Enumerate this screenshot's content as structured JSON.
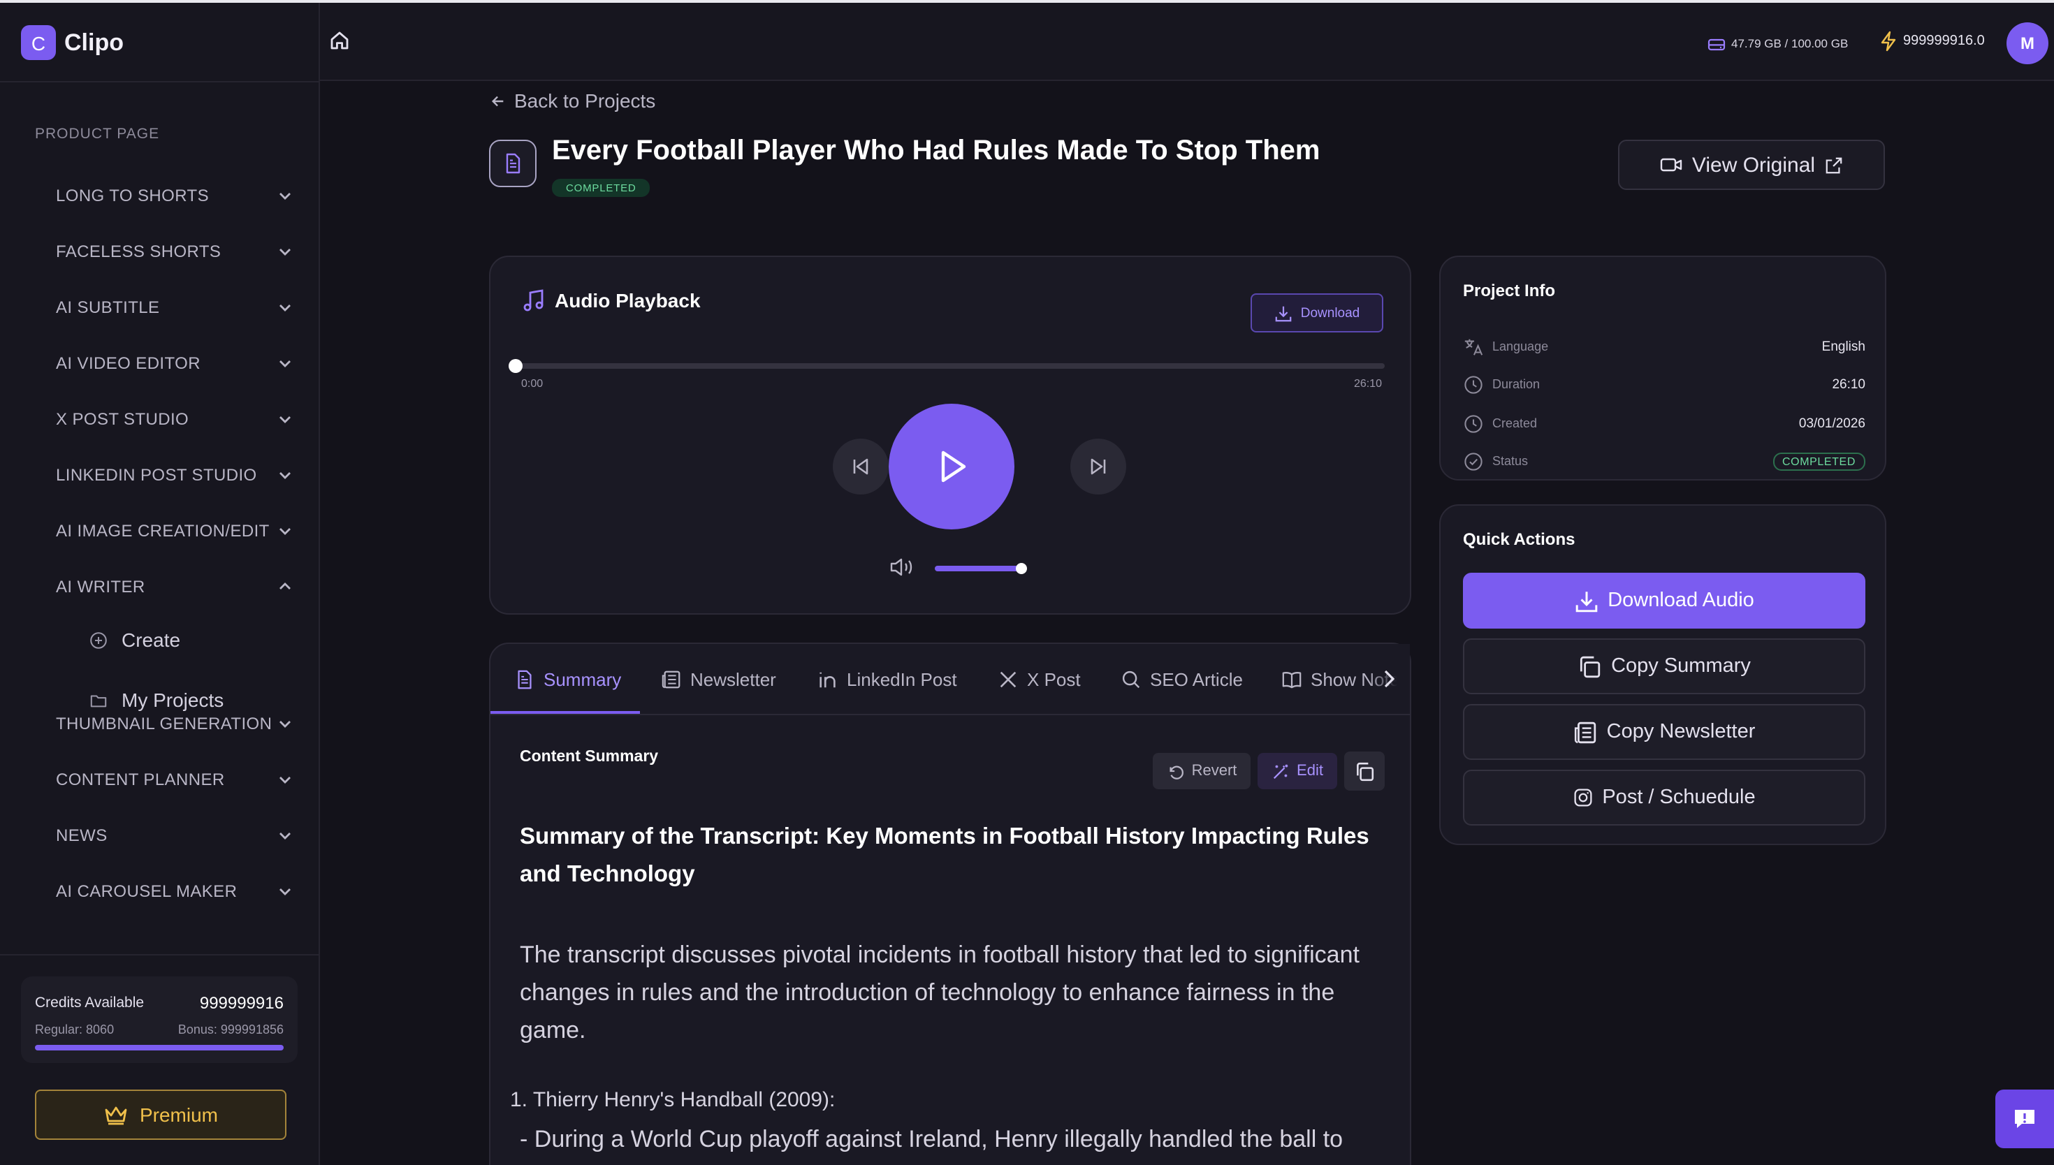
{
  "brand": {
    "logo_letter": "C",
    "name": "Clipo"
  },
  "sidebar": {
    "section_label": "PRODUCT PAGE",
    "items": [
      {
        "label": "LONG TO SHORTS",
        "expanded": false
      },
      {
        "label": "FACELESS SHORTS",
        "expanded": false
      },
      {
        "label": "AI SUBTITLE",
        "expanded": false
      },
      {
        "label": "AI VIDEO EDITOR",
        "expanded": false
      },
      {
        "label": "X POST STUDIO",
        "expanded": false
      },
      {
        "label": "LINKEDIN POST STUDIO",
        "expanded": false
      },
      {
        "label": "AI IMAGE CREATION/EDIT",
        "expanded": false
      },
      {
        "label": "AI WRITER",
        "expanded": true
      },
      {
        "label": "THUMBNAIL GENERATION",
        "expanded": false
      },
      {
        "label": "CONTENT PLANNER",
        "expanded": false
      },
      {
        "label": "NEWS",
        "expanded": false
      },
      {
        "label": "AI CAROUSEL MAKER",
        "expanded": false
      }
    ],
    "sub_items": [
      {
        "label": "Create",
        "icon": "plus-circle-icon"
      },
      {
        "label": "My Projects",
        "icon": "folder-icon"
      }
    ],
    "credits": {
      "label": "Credits Available",
      "value": "999999916",
      "regular": "Regular: 8060",
      "bonus": "Bonus: 999991856",
      "progress": 1.0
    },
    "premium_label": "Premium"
  },
  "header": {
    "storage": "47.79 GB / 100.00 GB",
    "credits": "999999916.0",
    "avatar_initial": "M"
  },
  "page": {
    "back_label": "Back to Projects",
    "title": "Every Football Player Who Had Rules Made To Stop Them",
    "status_badge": "COMPLETED",
    "view_original_label": "View Original"
  },
  "audio": {
    "title": "Audio Playback",
    "download_label": "Download",
    "current_time": "0:00",
    "total_time": "26:10",
    "progress": 0.0,
    "volume": 1.0
  },
  "tabs": {
    "items": [
      {
        "label": "Summary",
        "icon": "document-icon",
        "active": true
      },
      {
        "label": "Newsletter",
        "icon": "newspaper-icon",
        "active": false
      },
      {
        "label": "LinkedIn Post",
        "icon": "linkedin-icon",
        "active": false
      },
      {
        "label": "X Post",
        "icon": "x-icon",
        "active": false
      },
      {
        "label": "SEO Article",
        "icon": "search-icon",
        "active": false
      },
      {
        "label": "Show Notes",
        "icon": "book-icon",
        "active": false
      }
    ]
  },
  "content": {
    "label": "Content Summary",
    "revert_label": "Revert",
    "edit_label": "Edit",
    "heading": "Summary of the Transcript: Key Moments in Football History Impacting Rules and Technology",
    "paragraph": "The transcript discusses pivotal incidents in football history that led to significant changes in rules and the introduction of technology to enhance fairness in the game.",
    "item_1": "1. Thierry Henry's Handball (2009):",
    "bullet_1": "- During a World Cup playoff against Ireland, Henry illegally handled the ball to"
  },
  "project_info": {
    "title": "Project Info",
    "rows": [
      {
        "label": "Language",
        "value": "English",
        "icon": "translate-icon"
      },
      {
        "label": "Duration",
        "value": "26:10",
        "icon": "clock-icon"
      },
      {
        "label": "Created",
        "value": "03/01/2026",
        "icon": "clock-icon"
      },
      {
        "label": "Status",
        "value": "COMPLETED",
        "icon": "check-circle-icon"
      }
    ]
  },
  "quick_actions": {
    "title": "Quick Actions",
    "buttons": [
      {
        "label": "Download Audio",
        "icon": "download-icon"
      },
      {
        "label": "Copy Summary",
        "icon": "copy-icon"
      },
      {
        "label": "Copy Newsletter",
        "icon": "newspaper-icon"
      },
      {
        "label": "Post / Schuedule",
        "icon": "instagram-icon"
      }
    ]
  },
  "colors": {
    "accent": "#7b5cf0",
    "background": "#13121a",
    "success": "#6ddc9f",
    "premium": "#f0c04b"
  }
}
